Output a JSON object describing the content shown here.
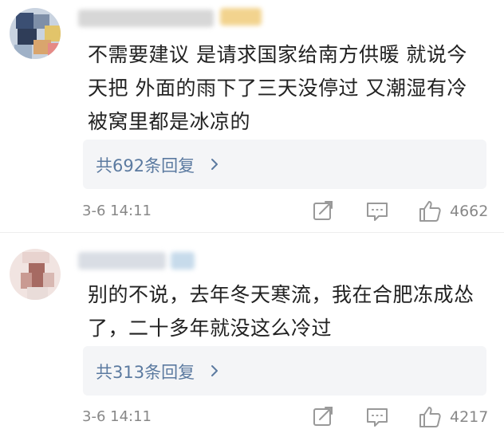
{
  "comments": [
    {
      "text_lines": [
        "不需要建议  是请求国家给南方供暖  就说今",
        "天把  外面的雨下了三天没停过  又潮湿有冷",
        "被窝里都是冰凉的"
      ],
      "replies_label": "共692条回复",
      "timestamp": "3-6 14:11",
      "like_count": "4662"
    },
    {
      "text_lines": [
        "别的不说，去年冬天寒流，我在合肥冻成怂",
        "了，二十多年就没这么冷过"
      ],
      "replies_label": "共313条回复",
      "timestamp": "3-6 14:11",
      "like_count": "4217"
    }
  ],
  "icons": {
    "avatar": "avatar-blurred",
    "chevron": "chevron-right-icon",
    "share": "share-icon",
    "reply": "comment-icon",
    "like": "thumbs-up-icon"
  },
  "colors": {
    "link": "#5b7aa0",
    "meta": "#888888",
    "text": "#222222",
    "reply_bg": "#f4f5f7"
  }
}
